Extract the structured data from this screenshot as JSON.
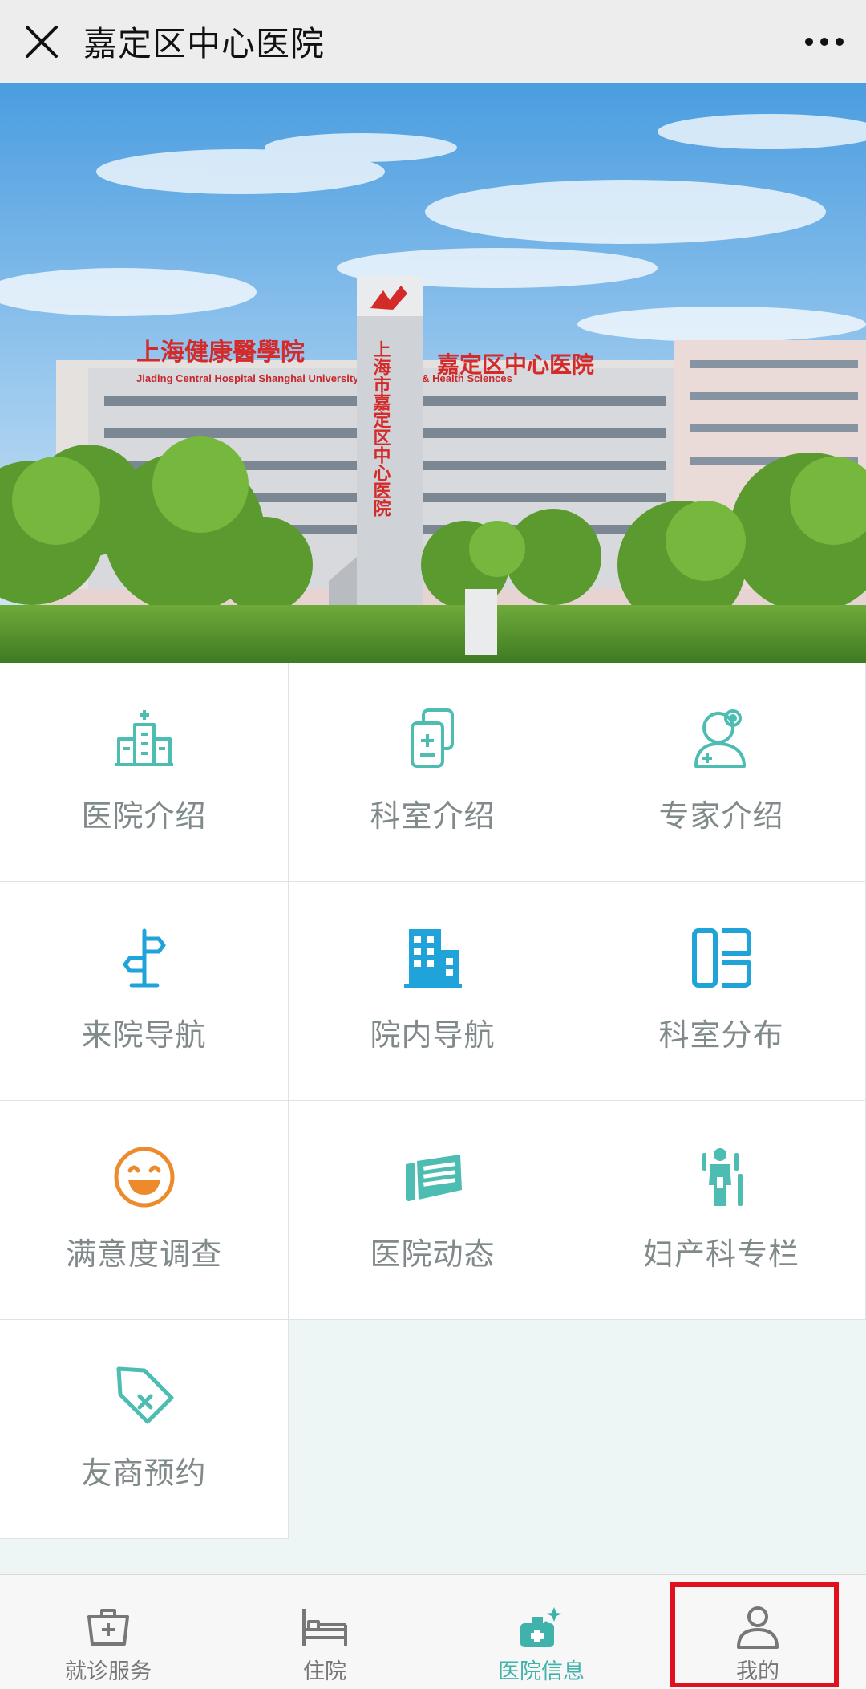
{
  "header": {
    "title": "嘉定区中心医院",
    "close_icon": "close-icon",
    "more_icon": "more-dots-icon"
  },
  "hero": {
    "signage_top": "上海健康醫學院",
    "signage_top_right": "嘉定区中心医院",
    "signage_en": "Jiading Central Hospital Shanghai University of Medicine & Health Sciences",
    "tower_text": "上海市嘉定区中心医院"
  },
  "grid": {
    "items": [
      {
        "label": "医院介绍",
        "icon": "hospital-building-icon",
        "color": "#4dbdb1"
      },
      {
        "label": "科室介绍",
        "icon": "department-docs-icon",
        "color": "#4dbdb1"
      },
      {
        "label": "专家介绍",
        "icon": "doctor-expert-icon",
        "color": "#4dbdb1"
      },
      {
        "label": "来院导航",
        "icon": "signpost-icon",
        "color": "#1fa3d8"
      },
      {
        "label": "院内导航",
        "icon": "building-icon",
        "color": "#1fa3d8"
      },
      {
        "label": "科室分布",
        "icon": "floor-plan-icon",
        "color": "#1fa3d8"
      },
      {
        "label": "满意度调查",
        "icon": "smile-icon",
        "color": "#ec8a2c"
      },
      {
        "label": "医院动态",
        "icon": "newspaper-icon",
        "color": "#4dbdb1"
      },
      {
        "label": "妇产科专栏",
        "icon": "maternity-icon",
        "color": "#4dbdb1"
      },
      {
        "label": "友商预约",
        "icon": "tag-icon",
        "color": "#4dbdb1"
      }
    ]
  },
  "tabbar": {
    "items": [
      {
        "label": "就诊服务",
        "icon": "medical-kit-icon"
      },
      {
        "label": "住院",
        "icon": "bed-icon"
      },
      {
        "label": "医院信息",
        "icon": "hospital-info-icon"
      },
      {
        "label": "我的",
        "icon": "user-icon"
      }
    ],
    "active_index": 2,
    "active_color": "#3fb3ab",
    "inactive_color": "#777777"
  },
  "highlight_color": "#e0101d"
}
